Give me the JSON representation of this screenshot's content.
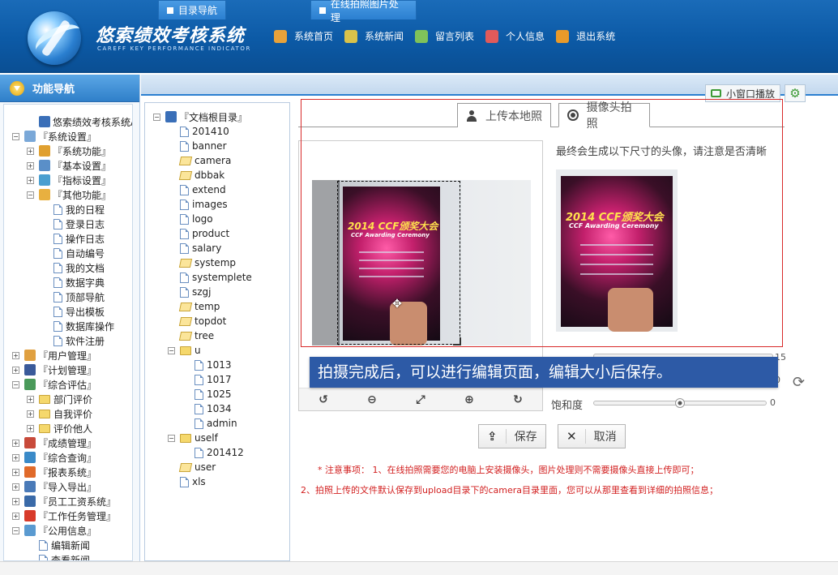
{
  "header": {
    "title": "悠索绩效考核系统",
    "subtitle": "CAREFF KEY PERFORMANCE INDICATOR",
    "nav": [
      {
        "label": "系统首页",
        "icon": "home-icon",
        "color": "#e8a23a"
      },
      {
        "label": "系统新闻",
        "icon": "news-icon",
        "color": "#d9c24a"
      },
      {
        "label": "留言列表",
        "icon": "messages-icon",
        "color": "#7fc25a"
      },
      {
        "label": "个人信息",
        "icon": "user-info-icon",
        "color": "#e05a5a"
      },
      {
        "label": "退出系统",
        "icon": "logout-icon",
        "color": "#e89a2a"
      }
    ]
  },
  "sidebar": {
    "title": "功能导航",
    "tree": [
      {
        "label": "悠索绩效考核系统A",
        "indent": 1,
        "toggle": "",
        "icon": "computer-icon"
      },
      {
        "label": "『系统设置』",
        "indent": 0,
        "toggle": "-",
        "icon": "settings-icon"
      },
      {
        "label": "『系统功能』",
        "indent": 1,
        "toggle": "+",
        "icon": "function-icon"
      },
      {
        "label": "『基本设置』",
        "indent": 1,
        "toggle": "+",
        "icon": "basic-settings-icon"
      },
      {
        "label": "『指标设置』",
        "indent": 1,
        "toggle": "+",
        "icon": "indicator-icon"
      },
      {
        "label": "『其他功能』",
        "indent": 1,
        "toggle": "-",
        "icon": "other-function-icon"
      },
      {
        "label": "我的日程",
        "indent": 2,
        "toggle": "",
        "icon": "doc-icon"
      },
      {
        "label": "登录日志",
        "indent": 2,
        "toggle": "",
        "icon": "doc-icon"
      },
      {
        "label": "操作日志",
        "indent": 2,
        "toggle": "",
        "icon": "doc-icon"
      },
      {
        "label": "自动编号",
        "indent": 2,
        "toggle": "",
        "icon": "doc-icon"
      },
      {
        "label": "我的文档",
        "indent": 2,
        "toggle": "",
        "icon": "doc-icon"
      },
      {
        "label": "数据字典",
        "indent": 2,
        "toggle": "",
        "icon": "doc-icon"
      },
      {
        "label": "顶部导航",
        "indent": 2,
        "toggle": "",
        "icon": "doc-icon"
      },
      {
        "label": "导出模板",
        "indent": 2,
        "toggle": "",
        "icon": "doc-icon"
      },
      {
        "label": "数据库操作",
        "indent": 2,
        "toggle": "",
        "icon": "doc-icon"
      },
      {
        "label": "软件注册",
        "indent": 2,
        "toggle": "",
        "icon": "doc-icon"
      },
      {
        "label": "『用户管理』",
        "indent": 0,
        "toggle": "+",
        "icon": "user-manage-icon"
      },
      {
        "label": "『计划管理』",
        "indent": 0,
        "toggle": "+",
        "icon": "plan-icon"
      },
      {
        "label": "『综合评估』",
        "indent": 0,
        "toggle": "-",
        "icon": "evaluation-icon"
      },
      {
        "label": "部门评价",
        "indent": 1,
        "toggle": "+",
        "icon": "folder-icon"
      },
      {
        "label": "自我评价",
        "indent": 1,
        "toggle": "+",
        "icon": "folder-icon"
      },
      {
        "label": "评价他人",
        "indent": 1,
        "toggle": "+",
        "icon": "folder-icon"
      },
      {
        "label": "『成绩管理』",
        "indent": 0,
        "toggle": "+",
        "icon": "calendar-icon"
      },
      {
        "label": "『综合查询』",
        "indent": 0,
        "toggle": "+",
        "icon": "search-icon"
      },
      {
        "label": "『报表系统』",
        "indent": 0,
        "toggle": "+",
        "icon": "chart-icon"
      },
      {
        "label": "『导入导出』",
        "indent": 0,
        "toggle": "+",
        "icon": "import-export-icon"
      },
      {
        "label": "『员工工资系统』",
        "indent": 0,
        "toggle": "+",
        "icon": "salary-icon"
      },
      {
        "label": "『工作任务管理』",
        "indent": 0,
        "toggle": "+",
        "icon": "task-flag-icon"
      },
      {
        "label": "『公用信息』",
        "indent": 0,
        "toggle": "-",
        "icon": "info-icon"
      },
      {
        "label": "编辑新闻",
        "indent": 1,
        "toggle": "",
        "icon": "doc-icon"
      },
      {
        "label": "查看新闻",
        "indent": 1,
        "toggle": "",
        "icon": "doc-icon"
      }
    ]
  },
  "tabs": [
    {
      "label": "目录导航"
    },
    {
      "label": "在线拍照图片处理"
    }
  ],
  "mini_window": {
    "label": "小窗口播放"
  },
  "dir_tree": [
    {
      "label": "『文档根目录』",
      "indent": 0,
      "toggle": "-",
      "icon": "computer-icon"
    },
    {
      "label": "201410",
      "indent": 1,
      "toggle": "",
      "icon": "doc-icon"
    },
    {
      "label": "banner",
      "indent": 1,
      "toggle": "",
      "icon": "doc-icon"
    },
    {
      "label": "camera",
      "indent": 1,
      "toggle": "",
      "icon": "folder-open"
    },
    {
      "label": "dbbak",
      "indent": 1,
      "toggle": "",
      "icon": "folder-open"
    },
    {
      "label": "extend",
      "indent": 1,
      "toggle": "",
      "icon": "doc-icon"
    },
    {
      "label": "images",
      "indent": 1,
      "toggle": "",
      "icon": "doc-icon"
    },
    {
      "label": "logo",
      "indent": 1,
      "toggle": "",
      "icon": "doc-icon"
    },
    {
      "label": "product",
      "indent": 1,
      "toggle": "",
      "icon": "doc-icon"
    },
    {
      "label": "salary",
      "indent": 1,
      "toggle": "",
      "icon": "doc-icon"
    },
    {
      "label": "systemp",
      "indent": 1,
      "toggle": "",
      "icon": "folder-open"
    },
    {
      "label": "systemplete",
      "indent": 1,
      "toggle": "",
      "icon": "doc-icon"
    },
    {
      "label": "szgj",
      "indent": 1,
      "toggle": "",
      "icon": "doc-icon"
    },
    {
      "label": "temp",
      "indent": 1,
      "toggle": "",
      "icon": "folder-open"
    },
    {
      "label": "topdot",
      "indent": 1,
      "toggle": "",
      "icon": "folder-open"
    },
    {
      "label": "tree",
      "indent": 1,
      "toggle": "",
      "icon": "folder-open"
    },
    {
      "label": "u",
      "indent": 1,
      "toggle": "-",
      "icon": "folder-icon"
    },
    {
      "label": "1013",
      "indent": 2,
      "toggle": "",
      "icon": "doc-icon"
    },
    {
      "label": "1017",
      "indent": 2,
      "toggle": "",
      "icon": "doc-icon"
    },
    {
      "label": "1025",
      "indent": 2,
      "toggle": "",
      "icon": "doc-icon"
    },
    {
      "label": "1034",
      "indent": 2,
      "toggle": "",
      "icon": "doc-icon"
    },
    {
      "label": "admin",
      "indent": 2,
      "toggle": "",
      "icon": "doc-icon"
    },
    {
      "label": "uself",
      "indent": 1,
      "toggle": "-",
      "icon": "folder-icon"
    },
    {
      "label": "201412",
      "indent": 2,
      "toggle": "",
      "icon": "doc-icon"
    },
    {
      "label": "user",
      "indent": 1,
      "toggle": "",
      "icon": "folder-open"
    },
    {
      "label": "xls",
      "indent": 1,
      "toggle": "",
      "icon": "doc-icon"
    }
  ],
  "photo": {
    "tab_upload": "上传本地照",
    "tab_camera": "摄像头拍照",
    "hint": "最终会生成以下尺寸的头像，请注意是否清晰",
    "poster_title": "2014 CCF颁奖大会",
    "poster_sub": "CCF Awarding Ceremony",
    "banner": "拍摄完成后，可以进行编辑页面，编辑大小后保存。",
    "slider_brightness_value": "15",
    "slider_contrast_value": "0",
    "saturation_label": "饱和度",
    "saturation_value": "0",
    "saturation_level": 0.5,
    "save": "保存",
    "cancel": "取消"
  },
  "notes": {
    "line1": "* 注意事项： 1、在线拍照需要您的电脑上安装摄像头，图片处理则不需要摄像头直接上传即可；",
    "line2": "2、拍照上传的文件默认保存到upload目录下的camera目录里面，您可以从那里查看到详细的拍照信息；"
  }
}
